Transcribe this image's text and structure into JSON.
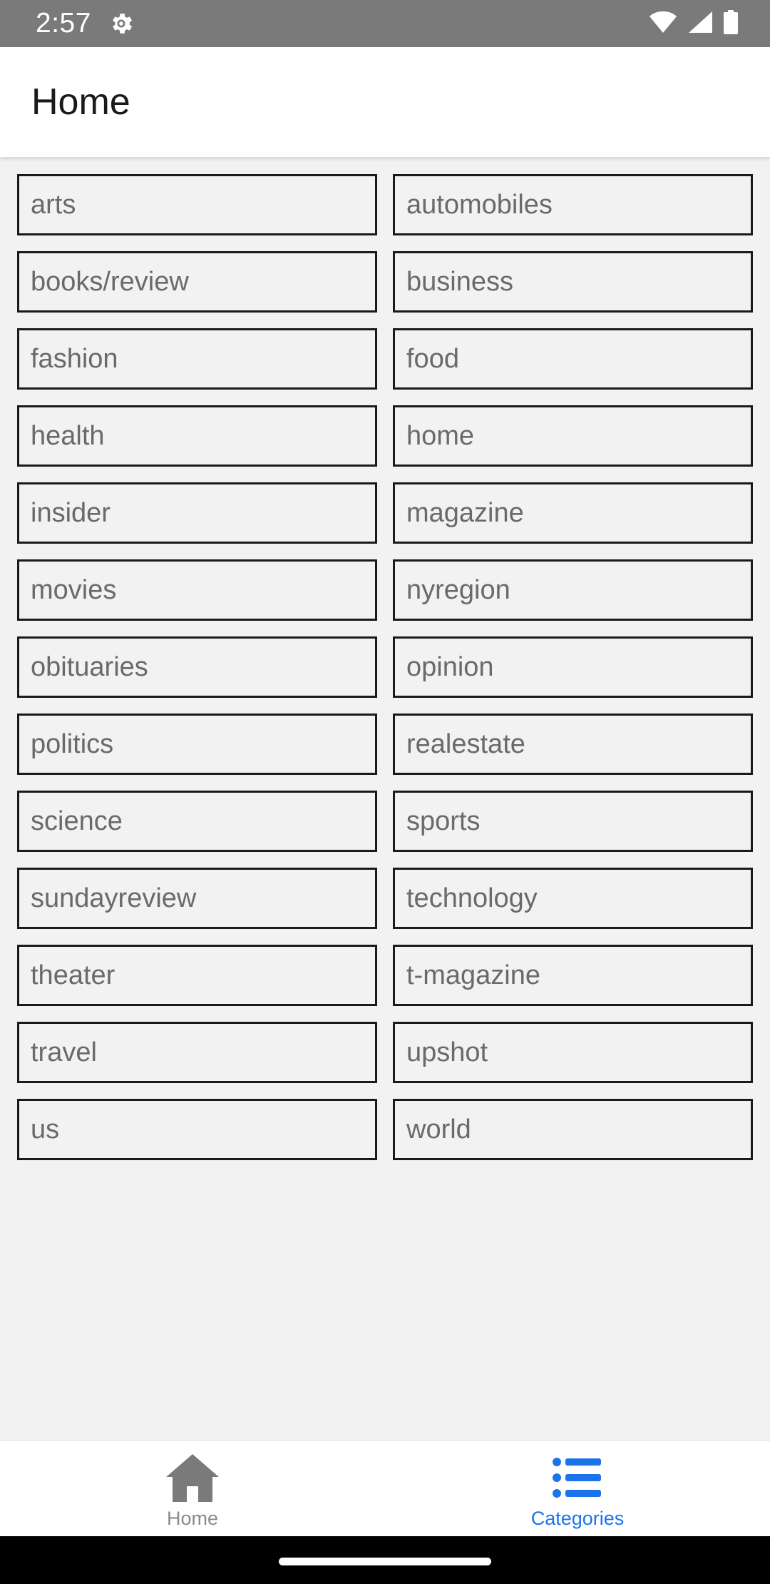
{
  "status_bar": {
    "time": "2:57",
    "icons": [
      "settings-gear-icon",
      "wifi-icon",
      "cell-signal-icon",
      "battery-icon"
    ]
  },
  "header": {
    "title": "Home"
  },
  "categories": [
    "arts",
    "automobiles",
    "books/review",
    "business",
    "fashion",
    "food",
    "health",
    "home",
    "insider",
    "magazine",
    "movies",
    "nyregion",
    "obituaries",
    "opinion",
    "politics",
    "realestate",
    "science",
    "sports",
    "sundayreview",
    "technology",
    "theater",
    "t-magazine",
    "travel",
    "upshot",
    "us",
    "world"
  ],
  "bottom_nav": {
    "items": [
      {
        "label": "Home",
        "icon": "home-icon",
        "active": false
      },
      {
        "label": "Categories",
        "icon": "list-icon",
        "active": true
      }
    ]
  },
  "colors": {
    "status_bar": "#7a7a7a",
    "background": "#f2f2f2",
    "accent": "#1a73e8",
    "inactive": "#8a8a8a",
    "cell_border": "#1a1a1a",
    "cell_text": "#6a6a6a"
  }
}
